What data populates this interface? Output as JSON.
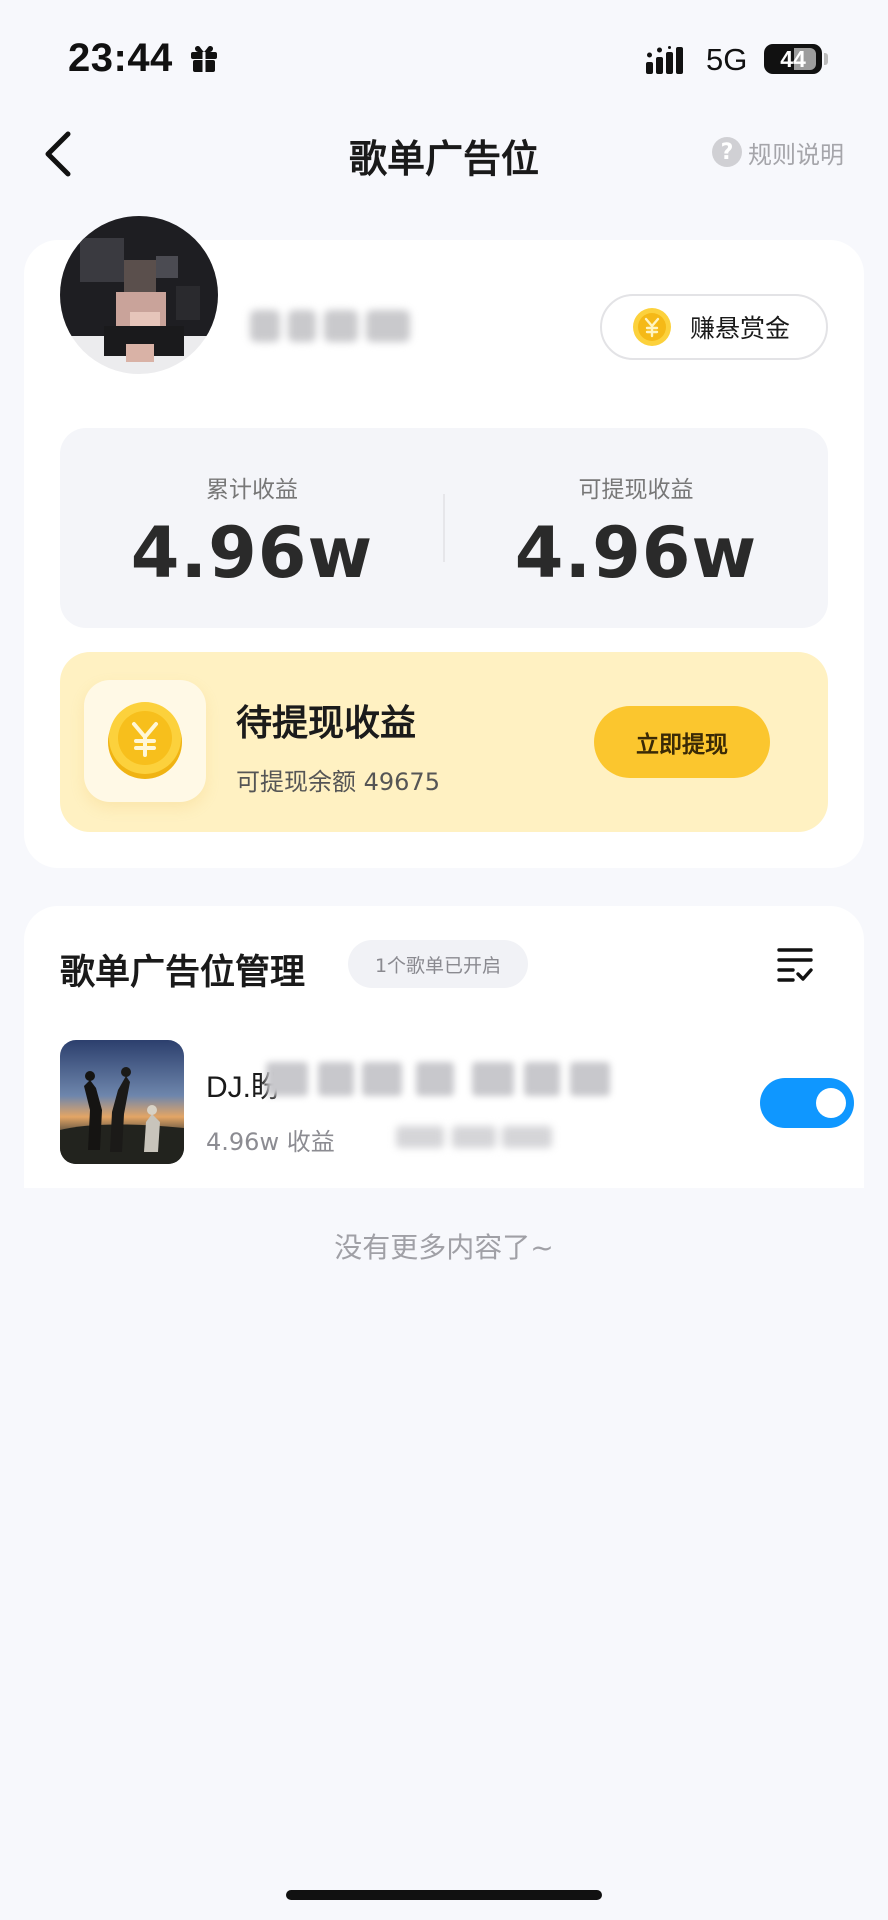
{
  "status_bar": {
    "time": "23:44",
    "network": "5G",
    "battery": "44",
    "icons": [
      "gift-icon",
      "signal-icon",
      "battery-icon"
    ]
  },
  "nav": {
    "title": "歌单广告位",
    "back_icon": "chevron-left-icon",
    "rules_label": "规则说明",
    "rules_icon": "question-circle-icon"
  },
  "profile": {
    "bounty_label": "赚悬赏金",
    "bounty_icon": "yen-coin-icon"
  },
  "stats": {
    "total_label": "累计收益",
    "total_value": "4.96w",
    "available_label": "可提现收益",
    "available_value": "4.96w"
  },
  "withdraw": {
    "title": "待提现收益",
    "subtitle": "可提现余额 49675",
    "button": "立即提现",
    "icon": "yen-coin-icon"
  },
  "manage": {
    "title": "歌单广告位管理",
    "badge": "1个歌单已开启",
    "sort_icon": "sort-list-icon",
    "items": [
      {
        "name": "DJ.盼",
        "meta": "4.96w 收益",
        "enabled": true
      }
    ]
  },
  "footer": {
    "no_more": "没有更多内容了~"
  },
  "colors": {
    "accent_blue": "#0f97ff",
    "accent_yellow": "#fbc62e",
    "panel_yellow": "#fff1c2",
    "background": "#f7f8fc"
  }
}
